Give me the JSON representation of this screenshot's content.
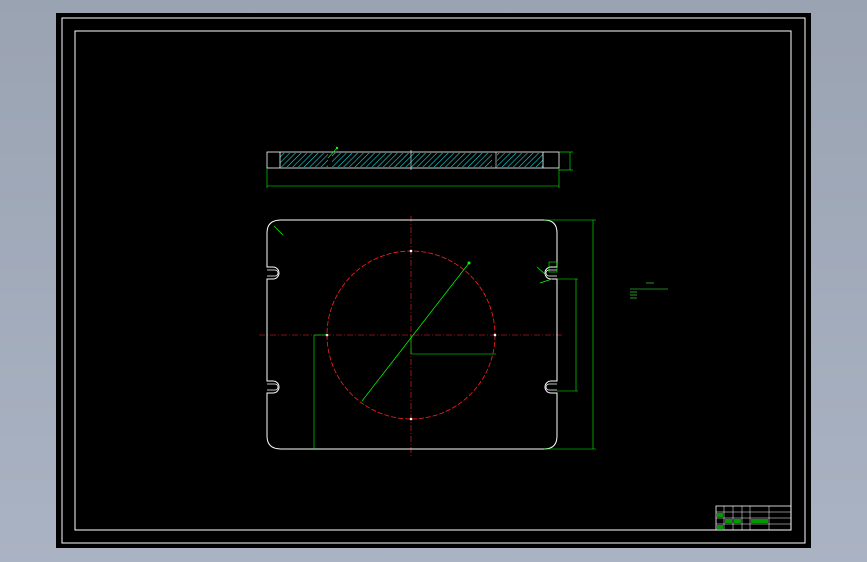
{
  "colors": {
    "outline": "#ffffff",
    "dimension": "#00ff00",
    "centerline": "#ff2020",
    "hatch": "#20d8d8",
    "notes": "#3cff3c"
  },
  "notes": {
    "title": "",
    "lines": [
      "",
      ""
    ]
  },
  "title_block": {
    "cells": [
      "",
      "",
      "",
      "",
      "",
      "",
      "",
      "",
      "",
      "",
      "",
      "",
      "",
      "",
      "",
      "",
      "",
      ""
    ]
  }
}
